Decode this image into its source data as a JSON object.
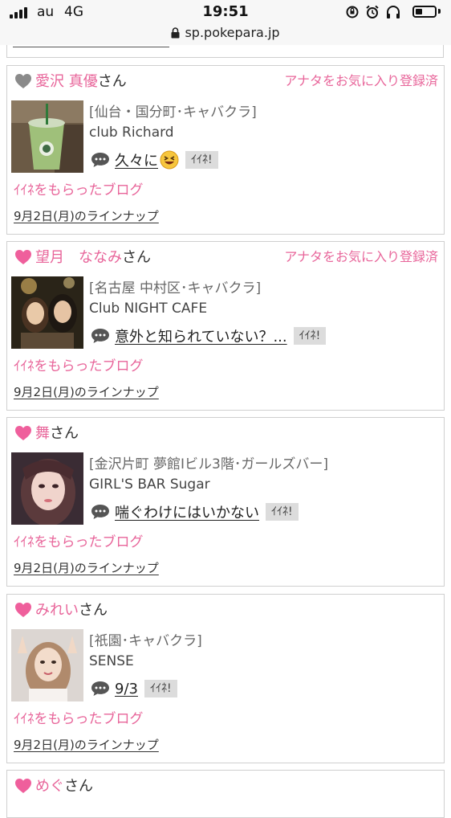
{
  "status_bar": {
    "carrier": "au",
    "network": "4G",
    "time": "19:51",
    "battery_level": 0.35
  },
  "browser": {
    "url": "sp.pokepara.jp"
  },
  "cards": [
    {
      "name": "愛沢 真優",
      "suffix": "さん",
      "heart_color": "#8a8a8a",
      "favorite_status": "アナタをお気に入り登録済",
      "area": "[仙台・国分町･キャバクラ]",
      "shop": "club Richard",
      "blog_title": "久々に",
      "blog_emoji": "grinning-squint-emoji",
      "iine_label": "ｲｲﾈ!",
      "received_label": "ｲｲﾈをもらったブログ",
      "lineup_label": "9月2日(月)のラインナップ"
    },
    {
      "name": "望月　ななみ",
      "suffix": "さん",
      "heart_color": "#ef5f9c",
      "favorite_status": "アナタをお気に入り登録済",
      "area": "[名古屋 中村区･キャバクラ]",
      "shop": "Club NIGHT CAFE",
      "blog_title": "意外と知られていない？...",
      "iine_label": "ｲｲﾈ!",
      "received_label": "ｲｲﾈをもらったブログ",
      "lineup_label": "9月2日(月)のラインナップ"
    },
    {
      "name": "舞",
      "suffix": "さん",
      "heart_color": "#ef5f9c",
      "favorite_status": "",
      "area": "[金沢片町 夢館Ⅰビル3階･ガールズバー]",
      "shop": "GIRL'S BAR Sugar",
      "blog_title": "喘ぐわけにはいかない",
      "iine_label": "ｲｲﾈ!",
      "received_label": "ｲｲﾈをもらったブログ",
      "lineup_label": "9月2日(月)のラインナップ"
    },
    {
      "name": "みれい",
      "suffix": "さん",
      "heart_color": "#ef5f9c",
      "favorite_status": "",
      "area": "[祇園･キャバクラ]",
      "shop": "SENSE",
      "blog_title": "9/3",
      "iine_label": "ｲｲﾈ!",
      "received_label": "ｲｲﾈをもらったブログ",
      "lineup_label": "9月2日(月)のラインナップ"
    }
  ],
  "next_card": {
    "name": "めぐ",
    "suffix": "さん",
    "heart_color": "#ef5f9c"
  }
}
